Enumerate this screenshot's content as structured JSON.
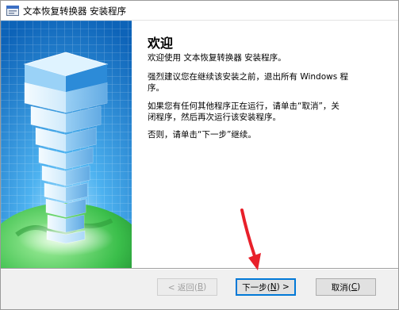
{
  "window": {
    "title": "文本恢复转换器 安装程序",
    "icon": "installer-app-icon"
  },
  "content": {
    "heading": "欢迎",
    "paragraphs": [
      [
        "欢迎使用 文本恢复转换器  安装程序。"
      ],
      [
        "强烈建议您在继续该安装之前，退出所有 Windows 程",
        "序。"
      ],
      [
        "如果您有任何其他程序正在运行，请单击“取消”，关",
        "闭程序，然后再次运行该安装程序。"
      ],
      [
        "否则，请单击“下一步”继续。"
      ]
    ]
  },
  "buttons": {
    "back": {
      "text": "< 返回(",
      "key": "B",
      "suffix": ")"
    },
    "next": {
      "text": "下一步(",
      "key": "N",
      "suffix": ") >"
    },
    "cancel": {
      "text": "取消(",
      "key": "C",
      "suffix": ")"
    }
  },
  "colors": {
    "banner_blue": "#1f86d6",
    "arrow_red": "#e8202a",
    "default_button_border": "#0078d7"
  }
}
